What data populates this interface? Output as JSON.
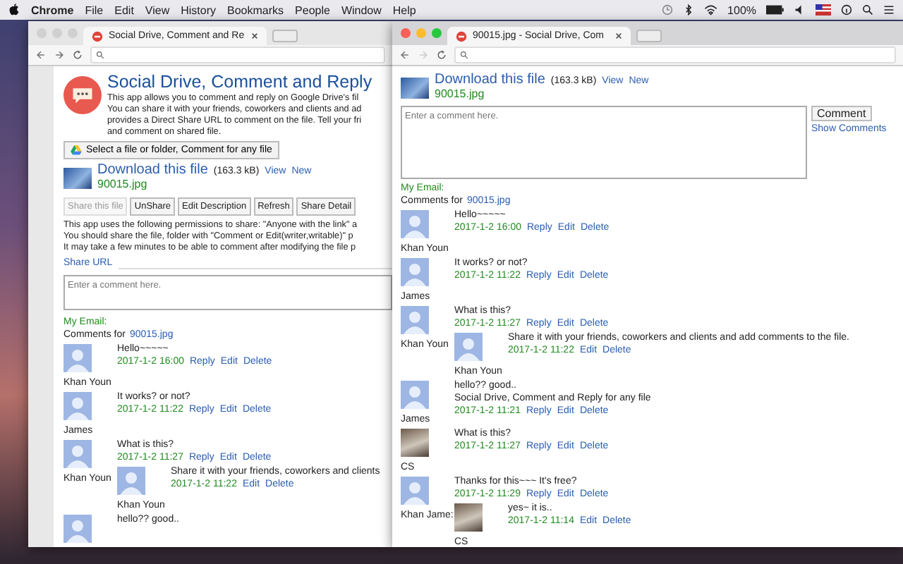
{
  "menu_bar": {
    "app": "Chrome",
    "items": [
      "File",
      "Edit",
      "View",
      "History",
      "Bookmarks",
      "People",
      "Window",
      "Help"
    ],
    "battery": "100%"
  },
  "back_window": {
    "active": false,
    "tab": {
      "title": "Social Drive, Comment and Re"
    },
    "app_title": "Social Drive, Comment and Reply",
    "intro": [
      "This app allows you to comment and reply on Google Drive's fil",
      "You can share it with your friends, coworkers and clients and ad",
      "provides a Direct Share URL to comment on the file. Tell your fri",
      "and comment on shared file."
    ],
    "select_button": "Select a file or folder, Comment for any file",
    "file": {
      "link": "Download this file",
      "size": "(163.3 kB)",
      "view": "View",
      "new": "New",
      "name": "90015.jpg"
    },
    "actions": [
      {
        "label": "Share this file",
        "disabled": true
      },
      {
        "label": "UnShare",
        "disabled": false
      },
      {
        "label": "Edit Description",
        "disabled": false
      },
      {
        "label": "Refresh",
        "disabled": false
      },
      {
        "label": "Share Detail",
        "disabled": false
      }
    ],
    "notes": [
      "This app uses the following permissions to share: \"Anyone with the link\" a",
      "You should share the file, folder with \"Comment or Edit(writer,writable)\" p",
      "It may take a few minutes to be able to comment after modifying the file p"
    ],
    "share_url": "Share URL",
    "comment_box": {
      "placeholder": "Enter a comment here."
    },
    "email_label": "My Email:",
    "comments_for": "Comments for",
    "comments_file": "90015.jpg",
    "comments": [
      {
        "author": "Khan Youn",
        "kind": "silhouette",
        "lines": [
          "Hello~~~~~"
        ],
        "date": "2017-1-2 16:00",
        "actions": [
          "Reply",
          "Edit",
          "Delete"
        ]
      },
      {
        "author": "James",
        "kind": "silhouette",
        "lines": [
          "It works? or not?"
        ],
        "date": "2017-1-2 11:22",
        "actions": [
          "Reply",
          "Edit",
          "Delete"
        ]
      },
      {
        "author": "Khan Youn",
        "kind": "silhouette",
        "lines": [
          "What is this?"
        ],
        "date": "2017-1-2 11:27",
        "actions": [
          "Reply",
          "Edit",
          "Delete"
        ],
        "children": [
          {
            "author": "Khan Youn",
            "kind": "silhouette",
            "lines": [
              "Share it with your friends, coworkers and clients"
            ],
            "date": "2017-1-2 11:22",
            "actions": [
              "Edit",
              "Delete"
            ]
          }
        ]
      },
      {
        "kind": "silhouette",
        "lines": [
          "hello?? good.."
        ]
      }
    ]
  },
  "front_window": {
    "active": true,
    "tab": {
      "title": "90015.jpg - Social Drive, Com"
    },
    "file": {
      "link": "Download this file",
      "size": "(163.3 kB)",
      "view": "View",
      "new": "New",
      "name": "90015.jpg"
    },
    "comment_box": {
      "placeholder": "Enter a comment here."
    },
    "comment_button": "Comment",
    "show_comments": "Show Comments",
    "email_label": "My Email:",
    "comments_for": "Comments for",
    "comments_file": "90015.jpg",
    "comments": [
      {
        "author": "Khan Youn",
        "kind": "silhouette",
        "lines": [
          "Hello~~~~~"
        ],
        "date": "2017-1-2 16:00",
        "actions": [
          "Reply",
          "Edit",
          "Delete"
        ]
      },
      {
        "author": "James",
        "kind": "silhouette",
        "lines": [
          "It works? or not?"
        ],
        "date": "2017-1-2 11:22",
        "actions": [
          "Reply",
          "Edit",
          "Delete"
        ]
      },
      {
        "author": "Khan Youn",
        "kind": "silhouette",
        "lines": [
          "What is this?"
        ],
        "date": "2017-1-2 11:27",
        "actions": [
          "Reply",
          "Edit",
          "Delete"
        ],
        "children": [
          {
            "author": "Khan Youn",
            "kind": "silhouette",
            "lines": [
              "Share it with your friends, coworkers and clients and add comments to the file."
            ],
            "date": "2017-1-2 11:22",
            "actions": [
              "Edit",
              "Delete"
            ]
          }
        ]
      },
      {
        "author": "James",
        "kind": "silhouette",
        "lines": [
          "hello?? good..",
          "Social Drive, Comment and Reply for any file"
        ],
        "date": "2017-1-2 11:21",
        "actions": [
          "Reply",
          "Edit",
          "Delete"
        ]
      },
      {
        "author": "CS",
        "kind": "photo",
        "lines": [
          "What is this?"
        ],
        "date": "2017-1-2 11:27",
        "actions": [
          "Reply",
          "Edit",
          "Delete"
        ]
      },
      {
        "author": "Khan Jame:",
        "kind": "silhouette",
        "lines": [
          "Thanks for this~~~ It's free?"
        ],
        "date": "2017-1-2 11:29",
        "actions": [
          "Reply",
          "Edit",
          "Delete"
        ],
        "children": [
          {
            "author": "CS",
            "kind": "photo",
            "lines": [
              "yes~ it is.."
            ],
            "date": "2017-1-2 11:14",
            "actions": [
              "Edit",
              "Delete"
            ]
          }
        ]
      }
    ]
  }
}
